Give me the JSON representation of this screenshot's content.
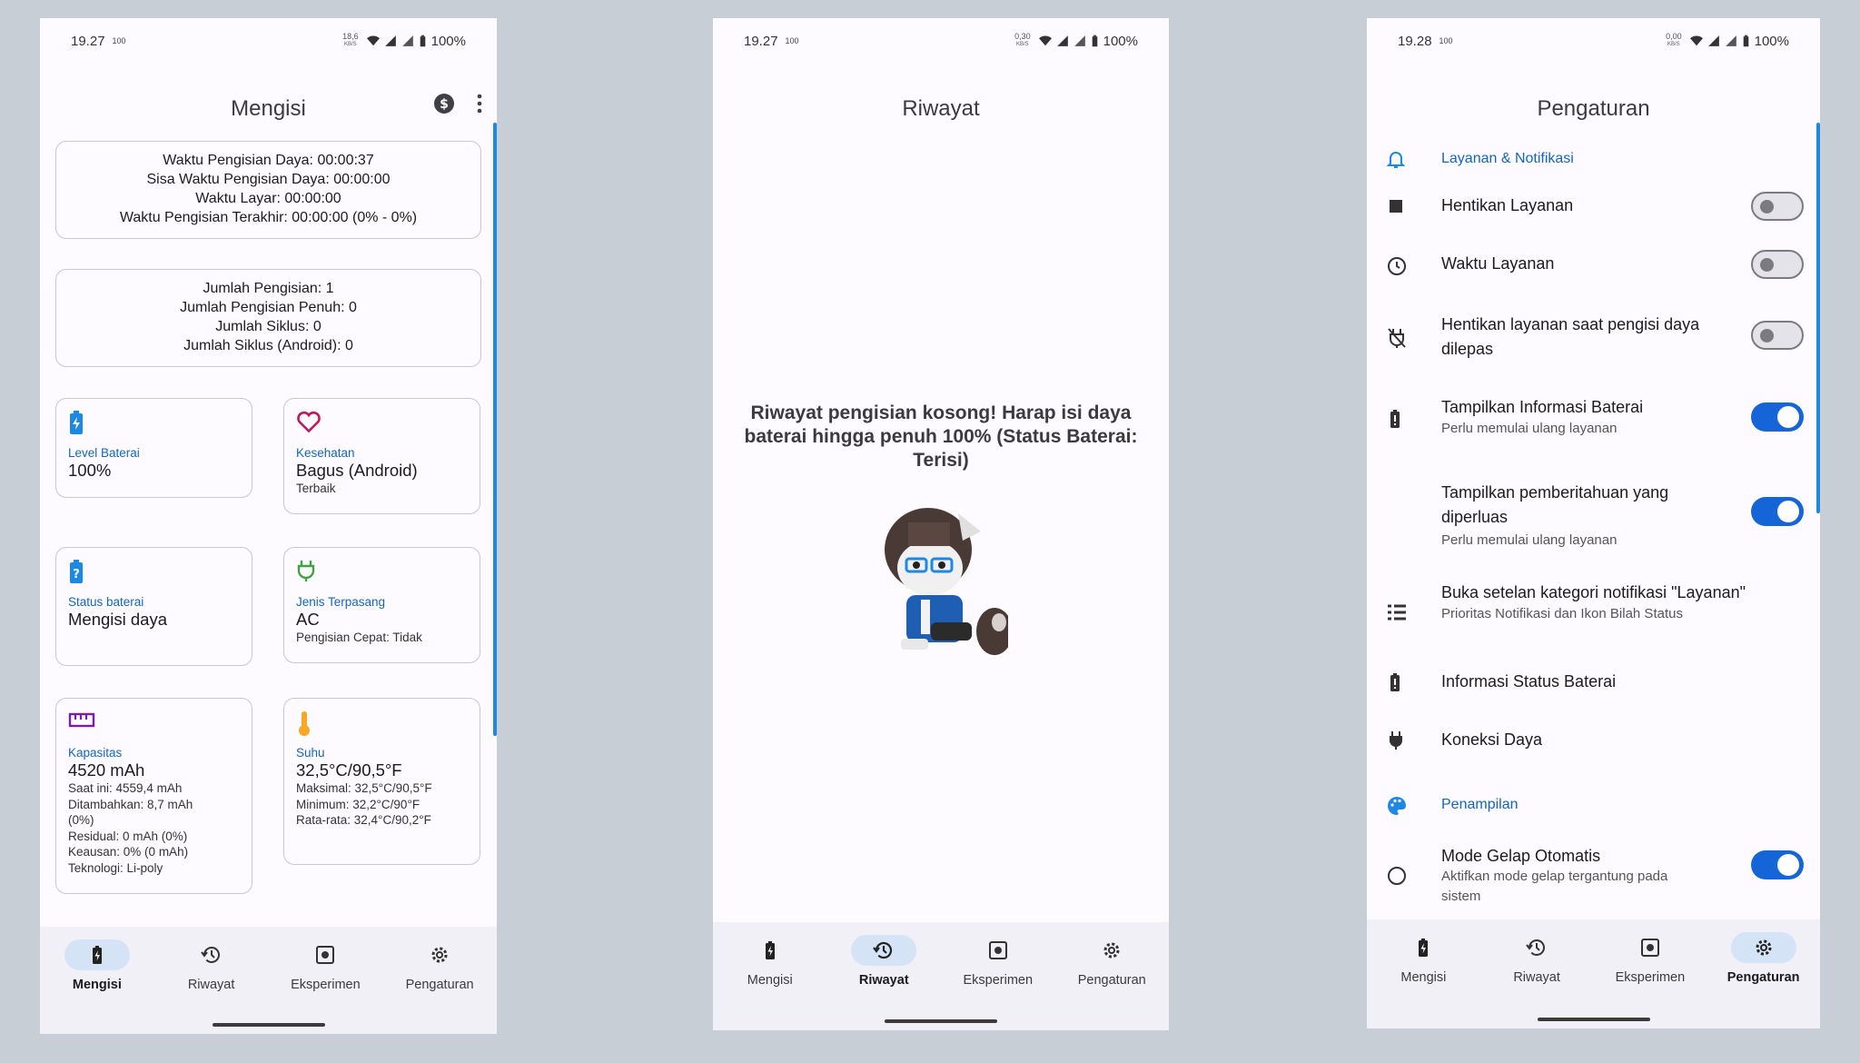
{
  "colors": {
    "accent": "#1565c0",
    "toggle_on": "#1565d8",
    "nav_active_bg": "#d5e3f7",
    "background": "#c8ced5"
  },
  "screen1": {
    "status": {
      "time": "19.27",
      "battery_badge": "100",
      "speed": "18,6",
      "speed_unit": "KB/S",
      "battery": "100%"
    },
    "title": "Mengisi",
    "icons": [
      "dollar-icon",
      "more-vert-icon"
    ],
    "charge_info": [
      "Waktu Pengisian Daya: 00:00:37",
      "Sisa Waktu Pengisian Daya: 00:00:00",
      "Waktu Layar: 00:00:00",
      "Waktu Pengisian Terakhir: 00:00:00 (0% - 0%)"
    ],
    "count_info": [
      "Jumlah Pengisian: 1",
      "Jumlah Pengisian Penuh: 0",
      "Jumlah Siklus: 0",
      "Jumlah Siklus (Android): 0"
    ],
    "tiles": {
      "level": {
        "label": "Level Baterai",
        "value": "100%"
      },
      "health": {
        "label": "Kesehatan",
        "value": "Bagus (Android)",
        "sub": "Terbaik"
      },
      "status": {
        "label": "Status baterai",
        "value": "Mengisi daya"
      },
      "plug": {
        "label": "Jenis Terpasang",
        "value": "AC",
        "sub": "Pengisian Cepat: Tidak"
      },
      "capacity": {
        "label": "Kapasitas",
        "value": "4520 mAh",
        "sub": [
          "Saat ini: 4559,4 mAh",
          "Ditambahkan: 8,7 mAh",
          "(0%)",
          "Residual: 0 mAh (0%)",
          "Keausan: 0% (0 mAh)",
          "Teknologi: Li-poly"
        ]
      },
      "temp": {
        "label": "Suhu",
        "value": "32,5°C/90,5°F",
        "sub": [
          "Maksimal: 32,5°C/90,5°F",
          "Minimum: 32,2°C/90°F",
          "Rata-rata: 32,4°C/90,2°F"
        ]
      }
    }
  },
  "screen2": {
    "status": {
      "time": "19.27",
      "battery_badge": "100",
      "speed": "0,30",
      "speed_unit": "KB/S",
      "battery": "100%"
    },
    "title": "Riwayat",
    "empty_message": "Riwayat pengisian kosong! Harap isi daya baterai hingga penuh 100% (Status Baterai: Terisi)"
  },
  "screen3": {
    "status": {
      "time": "19.28",
      "battery_badge": "100",
      "speed": "0,00",
      "speed_unit": "KB/S",
      "battery": "100%"
    },
    "title": "Pengaturan",
    "section1": "Layanan & Notifikasi",
    "rows": {
      "stop_service": "Hentikan Layanan",
      "service_time": "Waktu Layanan",
      "stop_unplug": "Hentikan layanan saat pengisi daya dilepas",
      "show_battery_info": "Tampilkan Informasi Baterai",
      "show_battery_info_sub": "Perlu memulai ulang layanan",
      "expanded_notif": "Tampilkan pemberitahuan yang diperluas",
      "expanded_notif_sub": "Perlu memulai ulang layanan",
      "open_channel": "Buka setelan kategori notifikasi \"Layanan\"",
      "open_channel_sub": "Prioritas Notifikasi dan Ikon Bilah Status",
      "battery_status_info": "Informasi Status Baterai",
      "power_connection": "Koneksi Daya",
      "auto_dark": "Mode Gelap Otomatis",
      "auto_dark_sub": "Aktifkan mode gelap tergantung pada sistem"
    },
    "section2": "Penampilan",
    "toggles": {
      "stop_service": false,
      "service_time": false,
      "stop_unplug": false,
      "show_battery_info": true,
      "expanded_notif": true,
      "auto_dark": true
    }
  },
  "nav": {
    "charge": "Mengisi",
    "history": "Riwayat",
    "experiment": "Eksperimen",
    "settings": "Pengaturan"
  }
}
